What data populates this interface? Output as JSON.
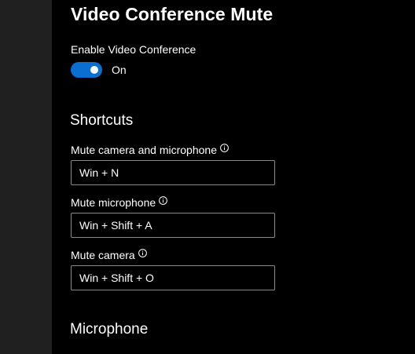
{
  "page": {
    "title": "Video Conference Mute"
  },
  "enable": {
    "label": "Enable Video Conference",
    "state_label": "On",
    "enabled": true
  },
  "shortcuts": {
    "section_title": "Shortcuts",
    "items": [
      {
        "label": "Mute camera and microphone",
        "value": "Win + N",
        "info_icon": "info-icon"
      },
      {
        "label": "Mute microphone",
        "value": "Win + Shift + A",
        "info_icon": "info-icon"
      },
      {
        "label": "Mute camera",
        "value": "Win + Shift + O",
        "info_icon": "info-icon"
      }
    ]
  },
  "microphone": {
    "section_title": "Microphone"
  },
  "colors": {
    "background": "#000000",
    "sidebar": "#202020",
    "accent": "#0a6fd1",
    "input_border": "#8a8a8a",
    "text": "#ffffff"
  }
}
